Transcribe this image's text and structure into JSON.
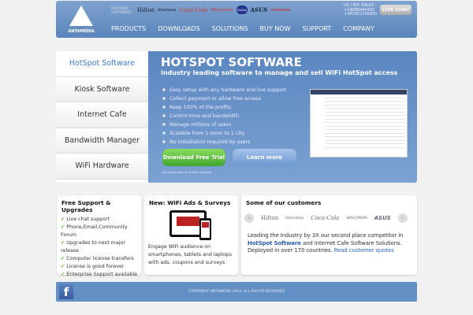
{
  "header": {
    "brand": "ANTAMEDIA",
    "featured": "FEATURED CUSTOMERS",
    "customers": [
      "Hilton",
      "Sheraton",
      "Coca-Cola",
      "Wisconsin",
      "NASA",
      "ASUS",
      "vodafone"
    ],
    "sales_label": "US / INT. SALES",
    "phone1": "+14088444480",
    "phone2": "+381652106600",
    "live_chat": "LIVE CHAT"
  },
  "nav": [
    "PRODUCTS",
    "DOWNLOADS",
    "SOLUTIONS",
    "BUY NOW",
    "SUPPORT",
    "COMPANY"
  ],
  "sidebar": [
    "HotSpot Software",
    "Kiosk Software",
    "Internet Cafe",
    "Bandwidth Manager",
    "WiFi Hardware"
  ],
  "hero": {
    "title": "HOTSPOT SOFTWARE",
    "subtitle": "Industry leading software to manage and sell WiFi HotSpot access",
    "bullets": [
      "Easy setup with any hardware and live support",
      "Collect payment or allow free access",
      "Keep 100% of the profits",
      "Control time and bandwidth",
      "Manage millions of users",
      "Scalable from 1 room to 1 city",
      "No installation required by users"
    ],
    "download": "Download Free Trial",
    "learn": "Learn more",
    "note": "No credit card or E-mail required"
  },
  "support": {
    "title": "Free Support & Upgrades",
    "items": [
      "Live chat support",
      "Phone,Email,Community Forum",
      "Upgrades to next major release",
      "Computer license transfers",
      "License is good forever",
      "Enterprise Support available"
    ]
  },
  "ads": {
    "title": "New: WiFi Ads & Surveys",
    "text": "Engage WiFi audience on smartphones, tablets and laptops with ads, coupons and surveys"
  },
  "customers": {
    "title": "Some of our customers",
    "logos": [
      "Hilton",
      "Sheraton",
      "Coca-Cola",
      "WISCONSIN",
      "ASUS"
    ],
    "text1": "Leading the Industry by 3X our second place competitor in",
    "link1": "HotSpot Software",
    "text2": " and Internet Cafe Software Solutions. Deployed in over 170 countries. ",
    "link2": "Read customer quotes"
  },
  "footer": {
    "copyright": "COPYRIGHT ANTAMEDIA 2014. ALL RIGHTS RESERVED"
  }
}
